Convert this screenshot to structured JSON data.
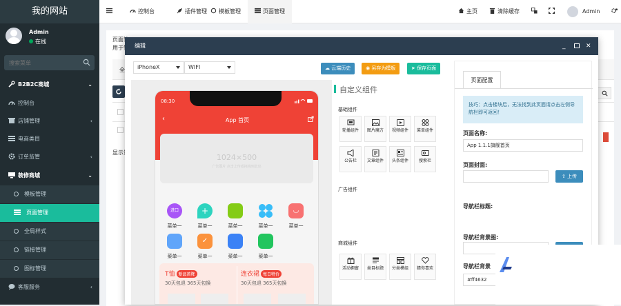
{
  "sidebar": {
    "brand": "我的网站",
    "user_name": "Admin",
    "user_status": "在线",
    "search_placeholder": "搜索菜单",
    "items": [
      {
        "label": "B2B2C商城",
        "icon": "wrench-icon",
        "type": "header"
      },
      {
        "label": "控制台",
        "icon": "dashboard-icon",
        "type": "item"
      },
      {
        "label": "店铺管理",
        "icon": "store-icon",
        "type": "item"
      },
      {
        "label": "电商类目",
        "icon": "list-icon",
        "type": "item"
      },
      {
        "label": "订单监管",
        "icon": "gear-icon",
        "type": "item"
      },
      {
        "label": "装修商城",
        "icon": "monitor-icon",
        "type": "open"
      },
      {
        "label": "模板管理",
        "type": "sub"
      },
      {
        "label": "页面管理",
        "type": "sub-active"
      },
      {
        "label": "全局样式",
        "type": "sub"
      },
      {
        "label": "链接管理",
        "type": "sub"
      },
      {
        "label": "图标管理",
        "type": "sub"
      },
      {
        "label": "客服服务",
        "icon": "chat-icon",
        "type": "item"
      }
    ]
  },
  "topbar": {
    "menu_icon": "hamburger-icon",
    "tabs": [
      {
        "label": "控制台",
        "icon": "dashboard-icon"
      },
      {
        "label": "插件管理",
        "icon": "rocket-icon"
      },
      {
        "label": "模板管理",
        "icon": "circle-icon"
      },
      {
        "label": "页面管理",
        "icon": "list-icon",
        "active": true
      }
    ],
    "home": "主页",
    "clear_cache": "清除缓存",
    "user": "Admin"
  },
  "background": {
    "title_partial": "页面管",
    "desc_partial": "用于管",
    "tab_partial": "全",
    "footer_partial": "显示第"
  },
  "modal": {
    "title": "编辑",
    "toolbar": {
      "device": "iPhoneX",
      "network": "WIFI",
      "cloud_history": "云端历史",
      "save_as_template": "另存为模板",
      "save_page": "保存页面"
    },
    "phone": {
      "time": "08:30",
      "title": "App 首页",
      "banner_size": "1024×500",
      "banner_sub": "广告图片  点击上传或拖拽到此处",
      "menu_label": "菜单一",
      "entry_label": "进口",
      "coupon_left_title": "T恤",
      "coupon_left_badge": "新品首降",
      "coupon_left_sub": "30天包退 365天包换",
      "coupon_right_title": "连衣裙",
      "coupon_right_badge": "每日特价",
      "coupon_right_sub": "30天包退 365天包换",
      "colors": {
        "header": "#ef4236"
      }
    },
    "palette": {
      "title": "自定义组件",
      "basic": "基础组件",
      "basic_items": [
        {
          "label": "轮播组件",
          "icon": "carousel-icon"
        },
        {
          "label": "图片魔方",
          "icon": "image-icon"
        },
        {
          "label": "视频组件",
          "icon": "video-icon"
        },
        {
          "label": "菜单组件",
          "icon": "grid-icon"
        },
        {
          "label": "公告栏",
          "icon": "megaphone-icon"
        },
        {
          "label": "文章组件",
          "icon": "article-icon"
        },
        {
          "label": "头条组件",
          "icon": "news-icon"
        },
        {
          "label": "搜索栏",
          "icon": "search-icon"
        }
      ],
      "ads": "广告组件",
      "mall": "商城组件",
      "mall_items": [
        {
          "label": "活动橱窗",
          "icon": "gift-icon"
        },
        {
          "label": "类目标题",
          "icon": "heading-icon"
        },
        {
          "label": "分类模组",
          "icon": "category-icon"
        },
        {
          "label": "猜你喜欢",
          "icon": "heart-icon"
        }
      ]
    },
    "config": {
      "tab": "页面配置",
      "tip": "技巧：点击楼块后，无法找到此页面请点击左侧导航栏即可返回！",
      "page_name_label": "页面名称:",
      "page_name_value": "App 1.1.1旗舰首页",
      "cover_label": "页面封面:",
      "upload": "上传",
      "nav_title_label": "导航栏标题:",
      "nav_bg_label": "导航栏背景图:",
      "nav_color_label": "导航栏背景",
      "nav_color_value": "#ff4632"
    }
  }
}
